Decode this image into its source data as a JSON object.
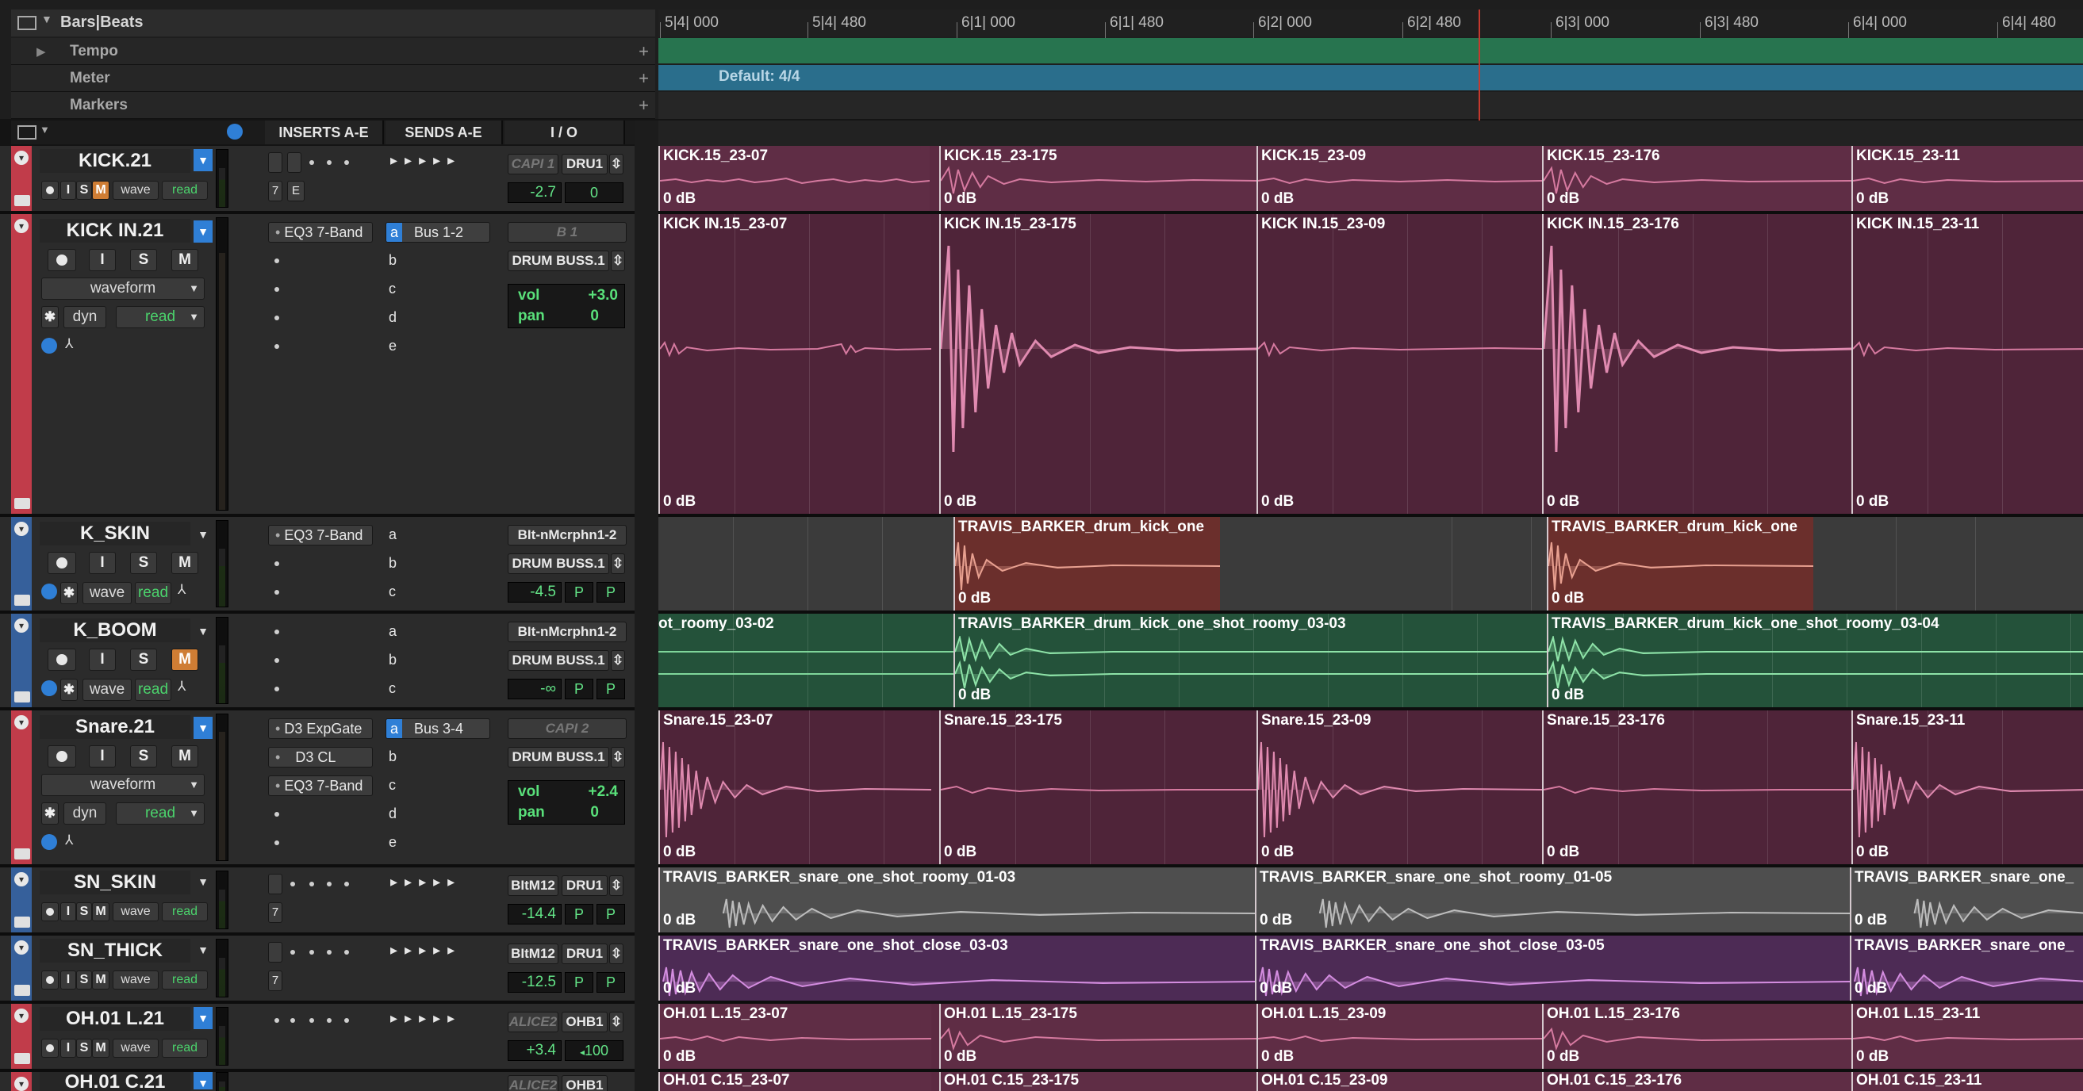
{
  "ruler": {
    "main_label": "Bars|Beats",
    "ticks": [
      "5|4| 000",
      "5|4| 480",
      "6|1| 000",
      "6|1| 480",
      "6|2| 000",
      "6|2| 480",
      "6|3| 000",
      "6|3| 480",
      "6|4| 000",
      "6|4| 480"
    ],
    "rows": [
      {
        "label": "Tempo"
      },
      {
        "label": "Meter",
        "region": "Default: 4/4"
      },
      {
        "label": "Markers"
      }
    ]
  },
  "columns": {
    "inserts": "INSERTS A-E",
    "sends": "SENDS A-E",
    "io": "I / O"
  },
  "tracks": [
    {
      "name": "KICK.21",
      "color": "#c13c4a",
      "view": "wave",
      "auto": "read",
      "io_in": "CAPI 1",
      "io_out": "DRU1",
      "vol": "-2.7",
      "pan": "0",
      "voice": "7",
      "extra": "E",
      "regions": [
        "KICK.15_23-07",
        "KICK.15_23-175",
        "KICK.15_23-09",
        "KICK.15_23-176",
        "KICK.15_23-11"
      ],
      "gain": "0 dB"
    },
    {
      "name": "KICK IN.21",
      "color": "#c13c4a",
      "view": "waveform",
      "dyn": "dyn",
      "auto": "read",
      "insert": "EQ3 7-Band",
      "send_a": "Bus 1-2",
      "io_in": "B 1",
      "io_out": "DRUM BUSS.1",
      "vol_label": "vol",
      "vol": "+3.0",
      "pan_label": "pan",
      "pan": "0",
      "regions": [
        "KICK IN.15_23-07",
        "KICK IN.15_23-175",
        "KICK IN.15_23-09",
        "KICK IN.15_23-176",
        "KICK IN.15_23-11"
      ],
      "gain": "0 dB"
    },
    {
      "name": "K_SKIN",
      "color": "#36609b",
      "view": "wave",
      "auto": "read",
      "insert": "EQ3 7-Band",
      "io_in": "BIt-nMcrphn1-2",
      "io_out": "DRUM BUSS.1",
      "vol": "-4.5",
      "pan": "P",
      "regions": [
        "TRAVIS_BARKER_drum_kick_one",
        "TRAVIS_BARKER_drum_kick_one"
      ],
      "gain": "0 dB"
    },
    {
      "name": "K_BOOM",
      "color": "#36609b",
      "view": "wave",
      "auto": "read",
      "io_in": "BIt-nMcrphn1-2",
      "io_out": "DRUM BUSS.1",
      "vol": "-∞",
      "pan": "P",
      "regions": [
        "ot_roomy_03-02",
        "TRAVIS_BARKER_drum_kick_one_shot_roomy_03-03",
        "TRAVIS_BARKER_drum_kick_one_shot_roomy_03-04"
      ],
      "gain": "0 dB"
    },
    {
      "name": "Snare.21",
      "color": "#c13c4a",
      "view": "waveform",
      "dyn": "dyn",
      "auto": "read",
      "inserts": [
        "D3 ExpGate",
        "D3 CL",
        "EQ3 7-Band"
      ],
      "send_a": "Bus 3-4",
      "io_in": "CAPI 2",
      "io_out": "DRUM BUSS.1",
      "vol_label": "vol",
      "vol": "+2.4",
      "pan_label": "pan",
      "pan": "0",
      "regions": [
        "Snare.15_23-07",
        "Snare.15_23-175",
        "Snare.15_23-09",
        "Snare.15_23-176",
        "Snare.15_23-11"
      ],
      "gain": "0 dB"
    },
    {
      "name": "SN_SKIN",
      "color": "#36609b",
      "view": "wave",
      "auto": "read",
      "io_in": "BItM12",
      "io_out": "DRU1",
      "vol": "-14.4",
      "pan": "P",
      "voice": "7",
      "regions": [
        "TRAVIS_BARKER_snare_one_shot_roomy_01-03",
        "TRAVIS_BARKER_snare_one_shot_roomy_01-05",
        "TRAVIS_BARKER_snare_one_"
      ],
      "gain": "0 dB"
    },
    {
      "name": "SN_THICK",
      "color": "#36609b",
      "view": "wave",
      "auto": "read",
      "io_in": "BItM12",
      "io_out": "DRU1",
      "vol": "-12.5",
      "pan": "P",
      "voice": "7",
      "regions": [
        "TRAVIS_BARKER_snare_one_shot_close_03-03",
        "TRAVIS_BARKER_snare_one_shot_close_03-05",
        "TRAVIS_BARKER_snare_one_"
      ],
      "gain": "0 dB"
    },
    {
      "name": "OH.01 L.21",
      "color": "#c13c4a",
      "view": "wave",
      "auto": "read",
      "io_in": "ALICE2",
      "io_out": "OHB1",
      "vol": "+3.4",
      "pan": "100",
      "regions": [
        "OH.01 L.15_23-07",
        "OH.01 L.15_23-175",
        "OH.01 L.15_23-09",
        "OH.01 L.15_23-176",
        "OH.01 L.15_23-11"
      ],
      "gain": "0 dB"
    },
    {
      "name": "OH.01 C.21",
      "color": "#c13c4a",
      "io_in": "ALICE2",
      "io_out": "OHB1",
      "regions": [
        "OH.01 C.15_23-07",
        "OH.01 C.15_23-175",
        "OH.01 C.15_23-09",
        "OH.01 C.15_23-176",
        "OH.01 C.15_23-11"
      ]
    }
  ],
  "buttons": {
    "input": "I",
    "solo": "S",
    "mute": "M"
  },
  "send_letters": [
    "a",
    "b",
    "c",
    "d",
    "e"
  ]
}
